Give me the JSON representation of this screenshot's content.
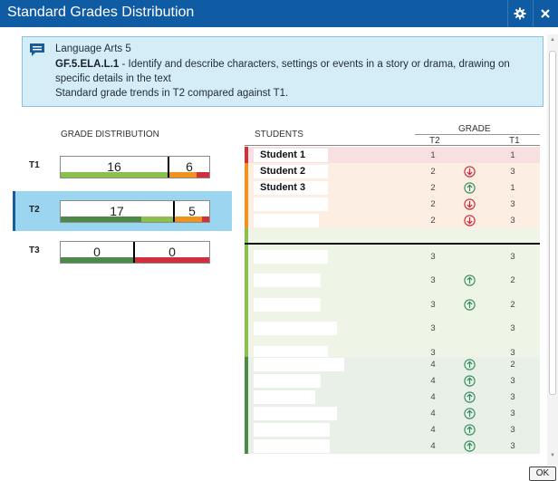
{
  "window": {
    "title": "Standard Grades Distribution"
  },
  "info": {
    "course": "Language Arts 5",
    "code": "GF.5.ELA.L.1",
    "desc_line1": " - Identify and describe characters, settings or events in a story or drama, drawing on",
    "desc_line2": "specific details in the text",
    "trend_text": "Standard grade trends in T2 compared against T1."
  },
  "headers": {
    "grade_distribution": "GRADE DISTRIBUTION",
    "students": "STUDENTS",
    "grade": "GRADE",
    "t2": "T2",
    "t1": "T1"
  },
  "terms": [
    {
      "label": "T1",
      "left": "16",
      "right": "6",
      "selected": false
    },
    {
      "label": "T2",
      "left": "17",
      "right": "5",
      "selected": true
    },
    {
      "label": "T3",
      "left": "0",
      "right": "0",
      "selected": false
    }
  ],
  "colors": {
    "red": "#d0303c",
    "orange": "#f0921e",
    "lightgreen": "#8cc04c",
    "darkgreen": "#4b8a48"
  },
  "students": [
    {
      "name": "Student 1",
      "t2": "1",
      "t1": "1",
      "trend": ""
    },
    {
      "name": "Student 2",
      "t2": "2",
      "t1": "3",
      "trend": "down"
    },
    {
      "name": "Student 3",
      "t2": "2",
      "t1": "1",
      "trend": "up"
    },
    {
      "name": "",
      "t2": "2",
      "t1": "3",
      "trend": "down"
    },
    {
      "name": "",
      "t2": "2",
      "t1": "3",
      "trend": "down"
    },
    {
      "name": "",
      "t2": "3",
      "t1": "3",
      "trend": ""
    },
    {
      "name": "",
      "t2": "3",
      "t1": "2",
      "trend": "up"
    },
    {
      "name": "",
      "t2": "3",
      "t1": "2",
      "trend": "up"
    },
    {
      "name": "",
      "t2": "3",
      "t1": "3",
      "trend": ""
    },
    {
      "name": "",
      "t2": "3",
      "t1": "3",
      "trend": ""
    },
    {
      "name": "",
      "t2": "4",
      "t1": "2",
      "trend": "up"
    },
    {
      "name": "",
      "t2": "4",
      "t1": "3",
      "trend": "up"
    },
    {
      "name": "",
      "t2": "4",
      "t1": "3",
      "trend": "up"
    },
    {
      "name": "",
      "t2": "4",
      "t1": "3",
      "trend": "up"
    },
    {
      "name": "",
      "t2": "4",
      "t1": "3",
      "trend": "up"
    },
    {
      "name": "",
      "t2": "4",
      "t1": "3",
      "trend": "up"
    }
  ],
  "footer": {
    "ok_label": "OK"
  }
}
